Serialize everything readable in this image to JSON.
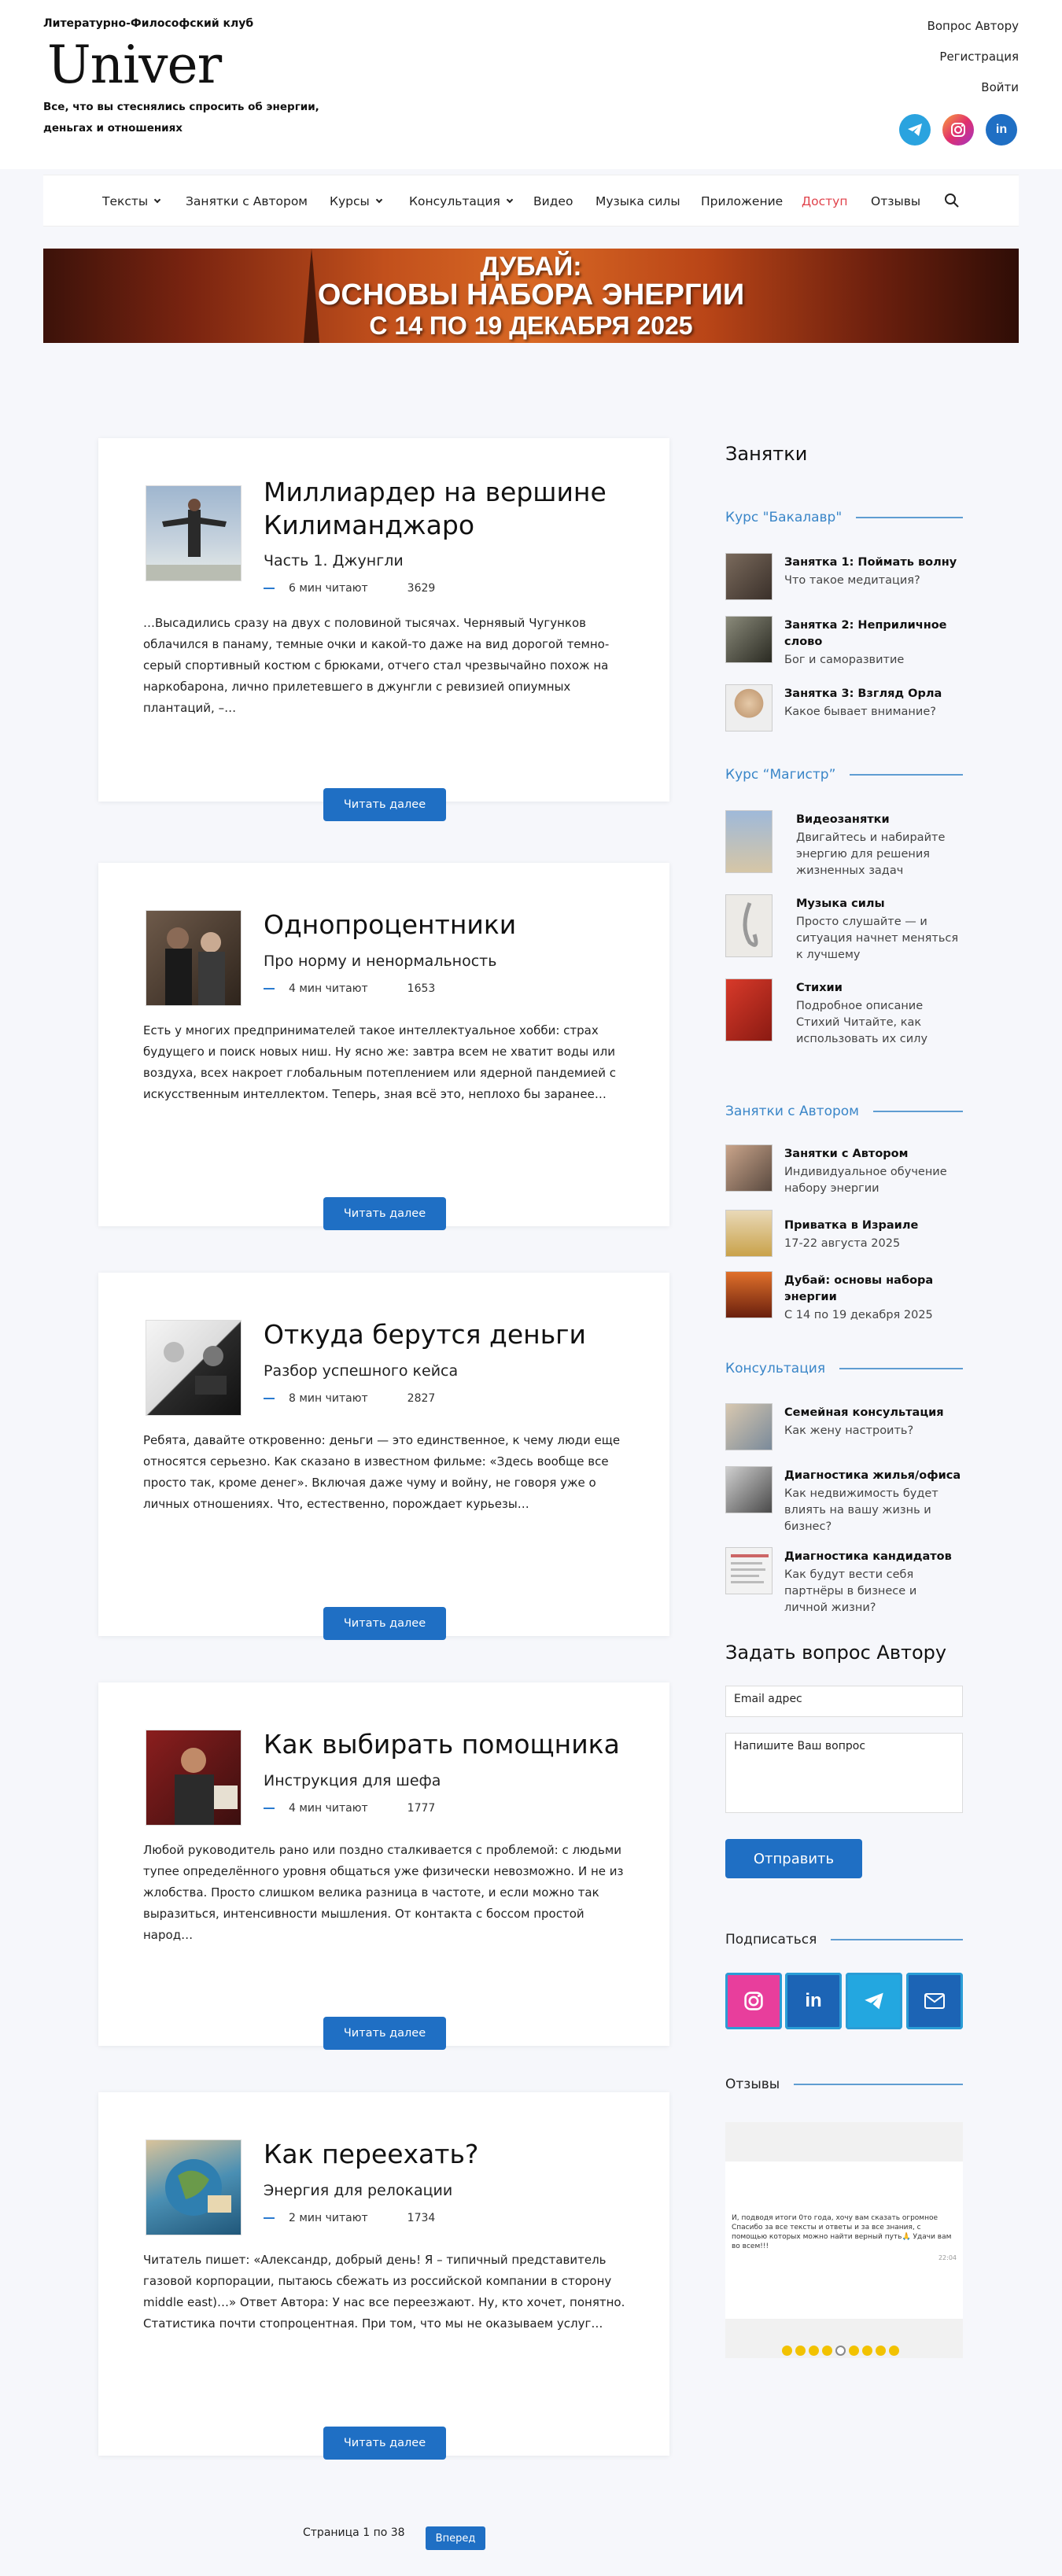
{
  "header": {
    "club_name": "Литературно-Философский клуб",
    "logo": "Univer",
    "tagline": "Все, что вы стеснялись спросить об энергии, деньгах и отношениях",
    "links": [
      "Вопрос Автору",
      "Регистрация",
      "Войти"
    ],
    "social_icons": [
      "telegram-icon",
      "instagram-icon",
      "linkedin-icon"
    ]
  },
  "nav": {
    "items": [
      {
        "label": "Тексты"
      },
      {
        "label": "Занятки с Автором"
      },
      {
        "label": "Курсы"
      },
      {
        "label": "Консультация"
      },
      {
        "label": "Видео"
      },
      {
        "label": "Музыка силы"
      },
      {
        "label": "Приложение"
      },
      {
        "label": "Доступ"
      },
      {
        "label": "Отзывы"
      }
    ],
    "search_icon": "search-icon",
    "accent_color": "#e0424b"
  },
  "banner": {
    "line1": "ДУБАЙ:",
    "line2": "ОСНОВЫ НАБОРА ЭНЕРГИИ",
    "line3": "С 14 ПО 19 ДЕКАБРЯ 2025"
  },
  "posts": [
    {
      "title": "Миллиардер на вершине Килиманджаро",
      "subtitle": "Часть 1. Джунгли",
      "read_time": "6 мин читают",
      "views": "3629",
      "excerpt": "…Высадились сразу на двух с половиной тысячах. Чернявый Чугунков облачился в панаму, темные очки и какой-то даже на вид дорогой темно-серый спортивный костюм с брюками, отчего стал чрезвычайно похож на наркобарона, лично прилетевшего в джунгли с ревизией опиумных плантаций, –…",
      "button": "Читать далее"
    },
    {
      "title": "Однопроцентники",
      "subtitle": "Про норму и ненормальность",
      "read_time": "4 мин читают",
      "views": "1653",
      "excerpt": "Есть у многих предпринимателей такое интеллектуальное хобби: страх будущего и поиск новых ниш. Ну ясно же: завтра всем не хватит воды или воздуха, всех накроет глобальным потеплением или ядерной пандемией с искусственным интеллектом. Теперь, зная всё это, неплохо бы заранее…",
      "button": "Читать далее"
    },
    {
      "title": "Откуда берутся деньги",
      "subtitle": "Разбор успешного кейса",
      "read_time": "8 мин читают",
      "views": "2827",
      "excerpt": "Ребята, давайте откровенно: деньги — это единственное, к чему люди еще относятся серьезно. Как сказано в известном фильме: «Здесь вообще все просто так, кроме денег». Включая даже чуму и войну, не говоря уже о личных отношениях. Что, естественно, порождает курьезы…",
      "button": "Читать далее"
    },
    {
      "title": "Как выбирать помощника",
      "subtitle": "Инструкция для шефа",
      "read_time": "4 мин читают",
      "views": "1777",
      "excerpt": "Любой руководитель рано или поздно сталкивается с проблемой: с людьми тупее определённого уровня общаться уже физически невозможно. И не из жлобства. Просто слишком велика разница в частоте, и если можно так выразиться, интенсивности мышления. От контакта с боссом простой народ…",
      "button": "Читать далее"
    },
    {
      "title": "Как переехать?",
      "subtitle": "Энергия для релокации",
      "read_time": "2 мин читают",
      "views": "1734",
      "excerpt": "Читатель пишет: «Александр, добрый день! Я – типичный представитель газовой корпорации, пытаюсь сбежать из российской компании в сторону middle east)…» Ответ Автора: У нас все переезжают. Ну, кто хочет, понятно. Статистика почти стопроцентная. При том, что мы не оказываем услуг…",
      "button": "Читать далее"
    }
  ],
  "pagination": {
    "text": "Страница 1 по 38",
    "next": "Вперед"
  },
  "sidebar": {
    "heading": "Занятки",
    "bachelor": {
      "title": "Курс \"Бакалавр\"",
      "items": [
        {
          "title": "Занятка 1: Поймать волну",
          "desc": "Что такое медитация?"
        },
        {
          "title": "Занятка 2: Неприличное слово",
          "desc": "Бог и саморазвитие"
        },
        {
          "title": "Занятка 3: Взгляд Орла",
          "desc": "Какое бывает внимание?"
        }
      ]
    },
    "master": {
      "title": "Курс “Магистр”",
      "items": [
        {
          "title": "Видеозанятки",
          "desc": "Двигайтесь и набирайте энергию для решения жизненных задач"
        },
        {
          "title": "Музыка силы",
          "desc": "Просто слушайте — и ситуация начнет меняться к лучшему"
        },
        {
          "title": "Стихии",
          "desc": "Подробное описание Стихий Читайте, как использовать их силу"
        }
      ]
    },
    "with_author": {
      "title": "Занятки с Автором",
      "items": [
        {
          "title": "Занятки с Автором",
          "desc": "Индивидуальное обучение набору энергии"
        },
        {
          "title": "Приватка в Израиле",
          "desc": "17-22 августа 2025"
        },
        {
          "title": "Дубай: основы набора энергии",
          "desc": "С 14 по 19 декабря 2025"
        }
      ]
    },
    "consult": {
      "title": "Консультация",
      "items": [
        {
          "title": "Семейная консультация",
          "desc": "Как жену настроить?"
        },
        {
          "title": "Диагностика жилья/офиса",
          "desc": "Как недвижимость будет влиять на вашу жизнь и бизнес?"
        },
        {
          "title": "Диагностика кандидатов",
          "desc": "Как будут вести себя партнёры в бизнесе и личной жизни?"
        }
      ]
    },
    "ask": {
      "heading": "Задать вопрос Автору",
      "email_placeholder": "Email адрес",
      "question_placeholder": "Напишите Ваш вопрос",
      "button": "Отправить"
    },
    "subscribe": {
      "title": "Подписаться",
      "icons": [
        "instagram-icon",
        "linkedin-icon",
        "telegram-icon",
        "mail-icon"
      ]
    },
    "reviews": {
      "title": "Отзывы",
      "text": "И, подводя итоги 0то года, хочу вам сказать огромное Спасибо за все тексты и ответы и за все знания, с помощью которых можно найти верный путь🙏 Удачи вам во всем!!!",
      "time": "22:04"
    }
  },
  "colors": {
    "primary": "#1f6fc4",
    "section": "#3a86c8",
    "dots": "#f2c200"
  }
}
